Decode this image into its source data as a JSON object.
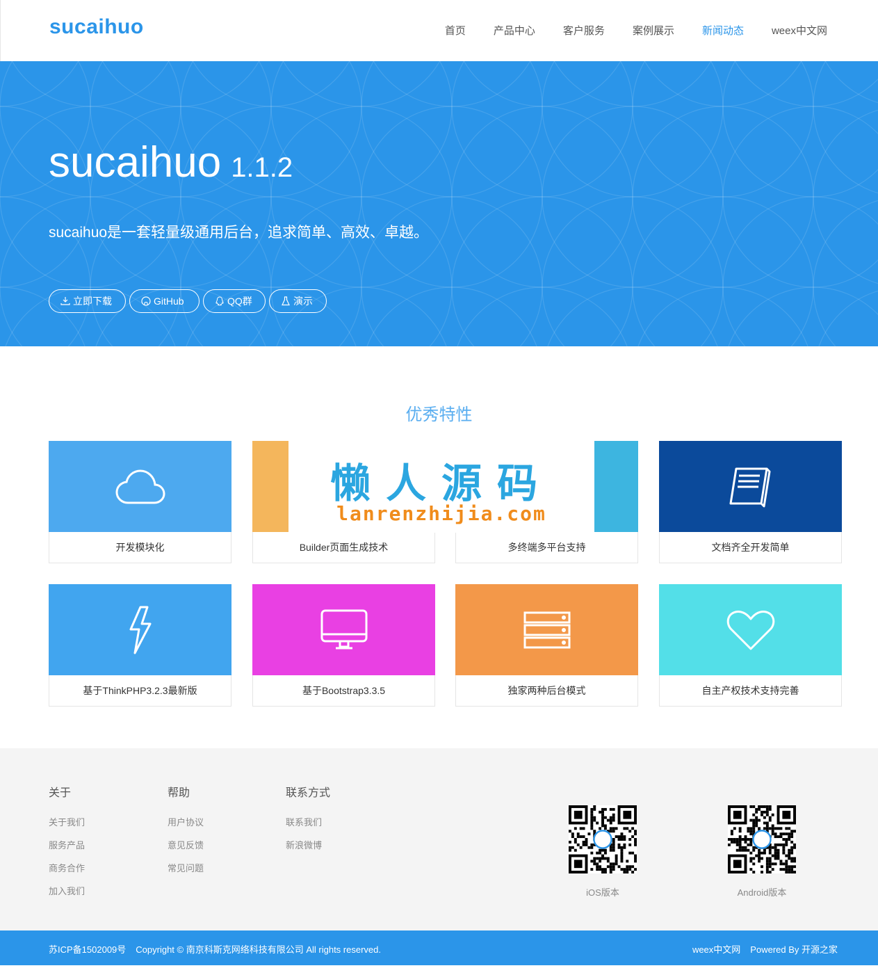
{
  "header": {
    "logo": "sucaihuo",
    "nav": [
      "首页",
      "产品中心",
      "客户服务",
      "案例展示",
      "新闻动态",
      "weex中文网"
    ],
    "active_nav": "新闻动态"
  },
  "hero": {
    "name": "sucaihuo",
    "version": "1.1.2",
    "subtitle": "sucaihuo是一套轻量级通用后台，追求简单、高效、卓越。",
    "buttons": [
      "立即下载",
      "GitHub",
      "QQ群",
      "演示"
    ]
  },
  "features": {
    "title": "优秀特性",
    "items": [
      {
        "label": "开发模块化",
        "icon": "cloud-icon",
        "color": "#4da9ef"
      },
      {
        "label": "Builder页面生成技术",
        "icon": "builder-icon",
        "color": "#f4b65c"
      },
      {
        "label": "多终端多平台支持",
        "icon": "devices-icon",
        "color": "#3db5e0"
      },
      {
        "label": "文档齐全开发简单",
        "icon": "book-icon",
        "color": "#0b4a9b"
      },
      {
        "label": "基于ThinkPHP3.2.3最新版",
        "icon": "lightning-icon",
        "color": "#41a5ef"
      },
      {
        "label": "基于Bootstrap3.3.5",
        "icon": "monitor-icon",
        "color": "#e940e3"
      },
      {
        "label": "独家两种后台模式",
        "icon": "server-icon",
        "color": "#f39849"
      },
      {
        "label": "自主产权技术支持完善",
        "icon": "heart-icon",
        "color": "#53dfe8"
      }
    ]
  },
  "watermark": {
    "cn": "懒人源码",
    "en": "lanrenzhijia.com"
  },
  "footer": {
    "about": {
      "title": "关于",
      "links": [
        "关于我们",
        "服务产品",
        "商务合作",
        "加入我们"
      ]
    },
    "help": {
      "title": "帮助",
      "links": [
        "用户协议",
        "意见反馈",
        "常见问题"
      ]
    },
    "contact": {
      "title": "联系方式",
      "links": [
        "联系我们",
        "新浪微博"
      ]
    },
    "qr_ios": "iOS版本",
    "qr_android": "Android版本"
  },
  "bottom": {
    "icp": "苏ICP备1502009号",
    "copyright": "Copyright © 南京科斯克网络科技有限公司 All rights reserved.",
    "links": [
      "weex中文网",
      "Powered By 开源之家"
    ]
  }
}
